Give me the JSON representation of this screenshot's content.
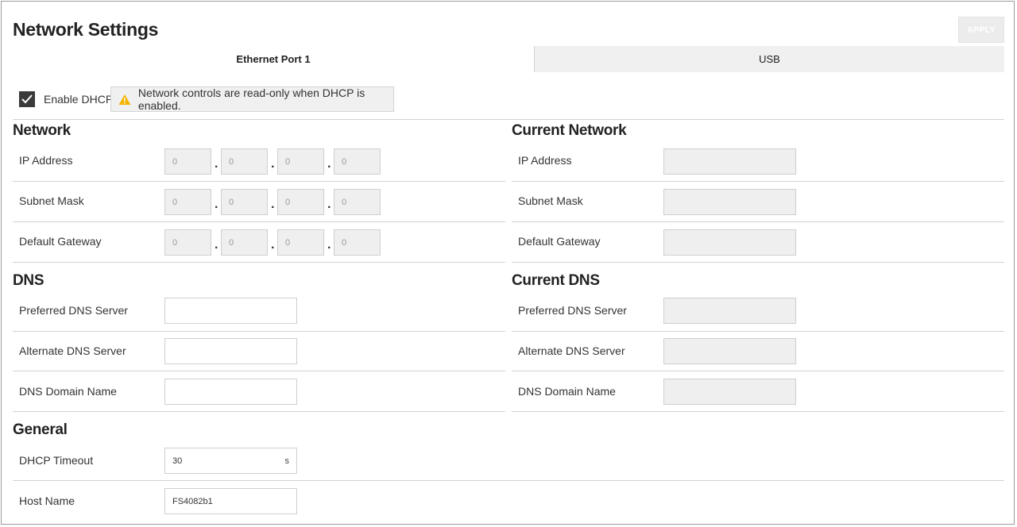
{
  "page": {
    "title": "Network Settings",
    "apply_label": "APPLY"
  },
  "tabs": [
    {
      "label": "Ethernet Port 1"
    },
    {
      "label": "USB"
    }
  ],
  "dhcp": {
    "label": "Enable DHCP",
    "checked": true,
    "notice": "Network controls are read-only when DHCP is enabled."
  },
  "network": {
    "title": "Network",
    "ip_label": "IP Address",
    "ip": [
      "0",
      "0",
      "0",
      "0"
    ],
    "subnet_label": "Subnet Mask",
    "subnet": [
      "0",
      "0",
      "0",
      "0"
    ],
    "gateway_label": "Default Gateway",
    "gateway": [
      "0",
      "0",
      "0",
      "0"
    ]
  },
  "current_network": {
    "title": "Current Network",
    "ip_label": "IP Address",
    "ip": "",
    "subnet_label": "Subnet Mask",
    "subnet": "",
    "gateway_label": "Default Gateway",
    "gateway": ""
  },
  "dns": {
    "title": "DNS",
    "preferred_label": "Preferred DNS Server",
    "preferred": "",
    "alternate_label": "Alternate DNS Server",
    "alternate": "",
    "domain_label": "DNS Domain Name",
    "domain": ""
  },
  "current_dns": {
    "title": "Current DNS",
    "preferred_label": "Preferred DNS Server",
    "preferred": "",
    "alternate_label": "Alternate DNS Server",
    "alternate": "",
    "domain_label": "DNS Domain Name",
    "domain": ""
  },
  "general": {
    "title": "General",
    "timeout_label": "DHCP Timeout",
    "timeout": "30",
    "timeout_unit": "s",
    "hostname_label": "Host Name",
    "hostname": "FS4082b1"
  },
  "colors": {
    "warning": "#f5b400",
    "checkbox": "#3a3a3a",
    "readonly_bg": "#efefef"
  },
  "icons": {
    "warning": "warning-triangle-icon",
    "check": "checkmark-icon"
  }
}
